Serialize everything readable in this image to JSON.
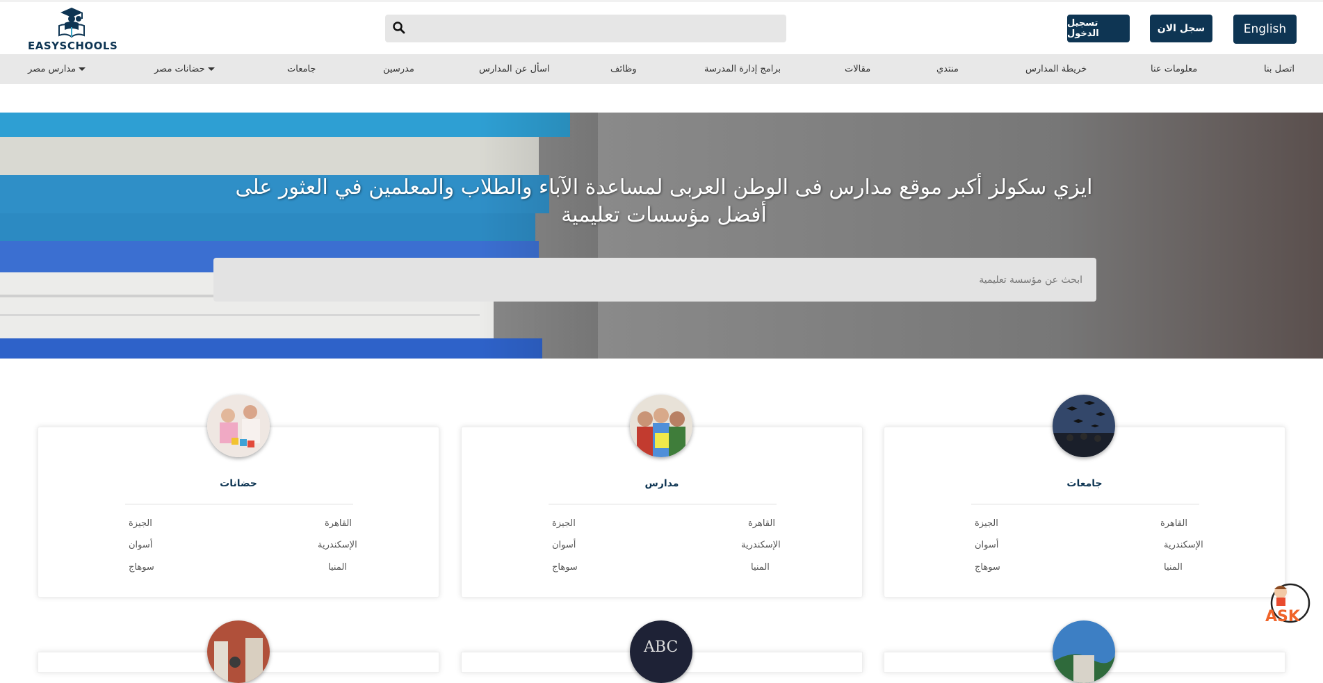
{
  "brand": {
    "logo_text": "EASYSCHOOLS"
  },
  "header": {
    "search_placeholder": "",
    "login_label": "تسجيل الدخول",
    "register_label": "سجل الان",
    "english_label": "English"
  },
  "nav": {
    "items": [
      {
        "label": "اتصل بنا"
      },
      {
        "label": "معلومات عنا"
      },
      {
        "label": "خريطة المدارس"
      },
      {
        "label": "منتدي"
      },
      {
        "label": "مقالات"
      },
      {
        "label": "برامج إدارة المدرسة"
      },
      {
        "label": "وظائف"
      },
      {
        "label": "اسأل عن المدارس"
      },
      {
        "label": "مدرسين"
      },
      {
        "label": "جامعات"
      },
      {
        "label": "حضانات مصر"
      },
      {
        "label": "مدارس مصر"
      }
    ]
  },
  "hero": {
    "title": "ايزي سكولز أكبر موقع مدارس فى الوطن العربى لمساعدة الآباء والطلاب والمعلمين في العثور على أفضل مؤسسات تعليمية",
    "search_placeholder": "ابحث عن مؤسسة تعليمية"
  },
  "cards": [
    {
      "title": "جامعات",
      "cities": [
        "القاهرة",
        "الجيزة",
        "الإسكندرية",
        "أسوان",
        "المنيا",
        "سوهاج"
      ]
    },
    {
      "title": "مدارس",
      "cities": [
        "القاهرة",
        "الجيزة",
        "الإسكندرية",
        "أسوان",
        "المنيا",
        "سوهاج"
      ]
    },
    {
      "title": "حضانات",
      "cities": [
        "القاهرة",
        "الجيزة",
        "الإسكندرية",
        "أسوان",
        "المنيا",
        "سوهاج"
      ]
    }
  ],
  "chalkboard_text": "ABC",
  "ask_widget": {
    "label": "ASK"
  },
  "colors": {
    "brand_dark": "#0e3553",
    "nav_bg": "#e8e8e8",
    "ask_orange": "#f0642a"
  }
}
